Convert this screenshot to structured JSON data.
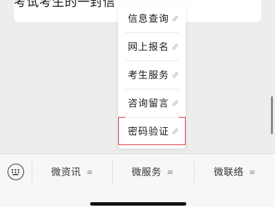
{
  "chat": {
    "card_title": "考试考生的一封信"
  },
  "popup_menu": {
    "items": [
      {
        "label": "信息查询",
        "icon": "link-icon"
      },
      {
        "label": "网上报名",
        "icon": "link-icon"
      },
      {
        "label": "考生服务",
        "icon": "link-icon"
      },
      {
        "label": "咨询留言",
        "icon": "link-icon"
      },
      {
        "label": "密码验证",
        "icon": "link-icon"
      }
    ]
  },
  "bottom_bar": {
    "keyboard_icon": "keyboard-icon",
    "tabs": [
      {
        "label": "微资讯",
        "icon": "menu-icon"
      },
      {
        "label": "微服务",
        "icon": "menu-icon"
      },
      {
        "label": "微联络",
        "icon": "menu-icon"
      }
    ]
  },
  "colors": {
    "highlight": "#d9363e",
    "background": "#ededed"
  }
}
